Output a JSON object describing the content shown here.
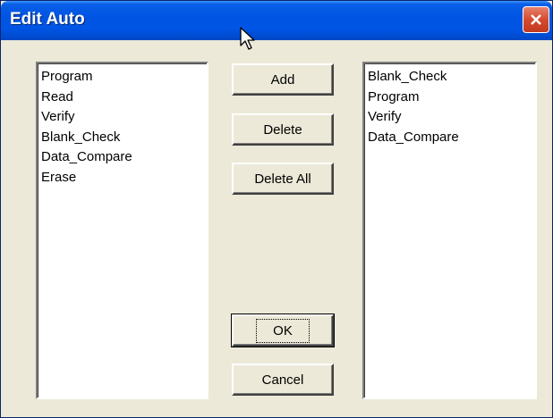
{
  "window": {
    "title": "Edit Auto"
  },
  "left_list": {
    "items": [
      "Program",
      "Read",
      "Verify",
      "Blank_Check",
      "Data_Compare",
      "Erase"
    ]
  },
  "right_list": {
    "items": [
      "Blank_Check",
      "Program",
      "Verify",
      "Data_Compare"
    ]
  },
  "buttons": {
    "add": "Add",
    "delete": "Delete",
    "delete_all": "Delete All",
    "ok": "OK",
    "cancel": "Cancel"
  },
  "icons": {
    "close": "close-icon",
    "cursor": "mouse-pointer-icon"
  },
  "colors": {
    "titlebar": "#0054e3",
    "close": "#d54a2f",
    "dialog_bg": "#ece9d8"
  }
}
